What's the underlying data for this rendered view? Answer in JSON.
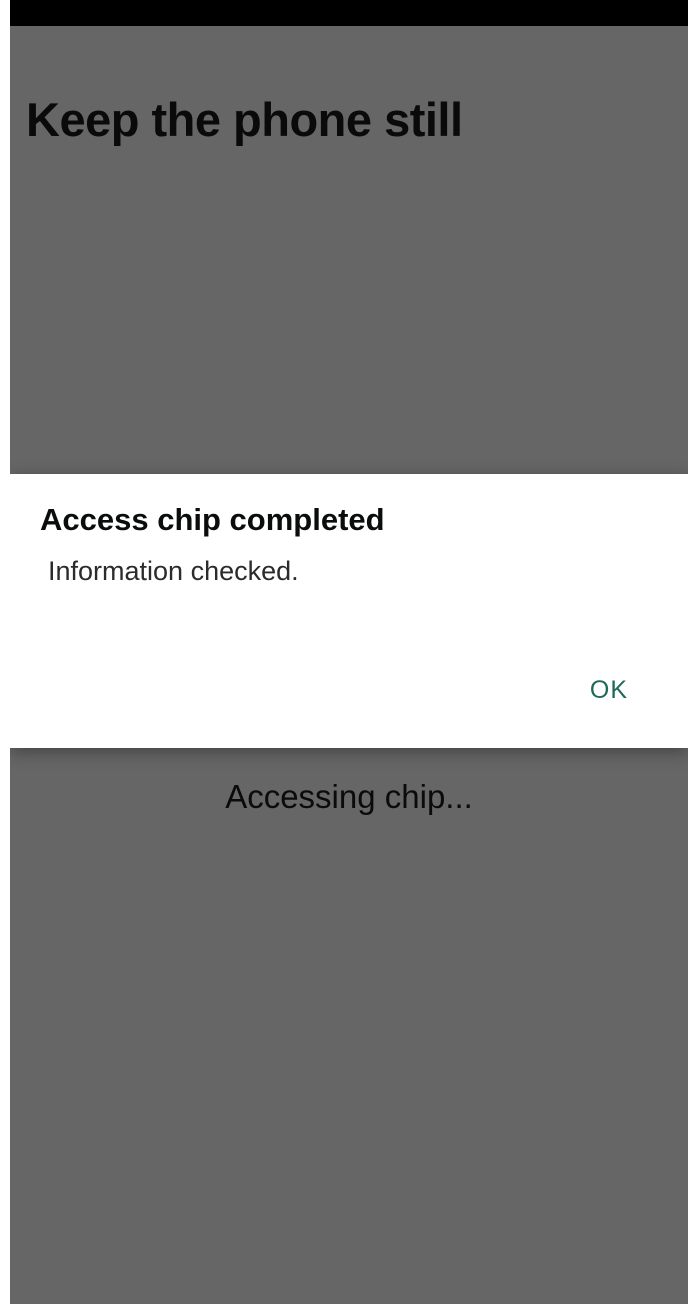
{
  "screen": {
    "title": "Keep the phone still",
    "status": "Accessing chip..."
  },
  "dialog": {
    "title": "Access chip completed",
    "message": "Information checked.",
    "ok_label": "OK"
  },
  "colors": {
    "scrim_background": "#666666",
    "dialog_background": "#ffffff",
    "ok_button_text": "#1f6a57",
    "title_text": "#0a0a0a"
  }
}
